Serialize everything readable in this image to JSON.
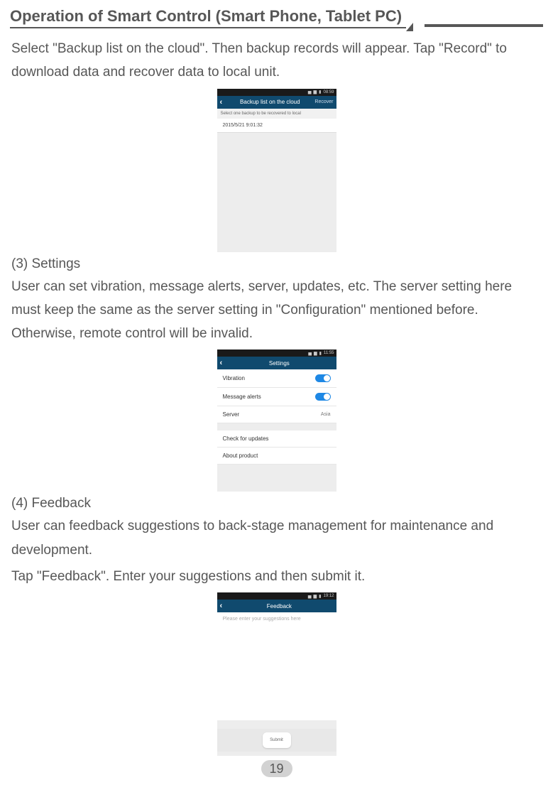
{
  "header": {
    "title": "Operation of Smart Control (Smart Phone, Tablet PC)"
  },
  "section_backup": {
    "text": "Select \"Backup list on the cloud\". Then backup records will appear. Tap \"Record\" to download data and recover data to local unit."
  },
  "phone1": {
    "status_time": "08:59",
    "nav_title": "Backup list on the cloud",
    "nav_right": "Recover",
    "hint": "Select one backup to be recovered to local",
    "record": "2015/5/21 9:01:32"
  },
  "section_settings": {
    "heading": "(3) Settings",
    "text": "User can set vibration, message alerts, server, updates, etc. The server setting here must keep the same as the server setting in \"Configuration\" mentioned before. Otherwise, remote control will be invalid."
  },
  "phone2": {
    "status_time": "11:55",
    "nav_title": "Settings",
    "rows": {
      "vibration": "Vibration",
      "message_alerts": "Message alerts",
      "server_label": "Server",
      "server_value": "Asia",
      "check_updates": "Check for updates",
      "about": "About product"
    }
  },
  "section_feedback": {
    "heading": "(4) Feedback",
    "text1": "User can feedback suggestions to back-stage management for maintenance and development.",
    "text2": "Tap \"Feedback\". Enter your suggestions and then submit it."
  },
  "phone3": {
    "status_time": "19:12",
    "nav_title": "Feedback",
    "placeholder": "Please enter your suggestions here",
    "submit": "Submit"
  },
  "footer": {
    "page": "19"
  }
}
